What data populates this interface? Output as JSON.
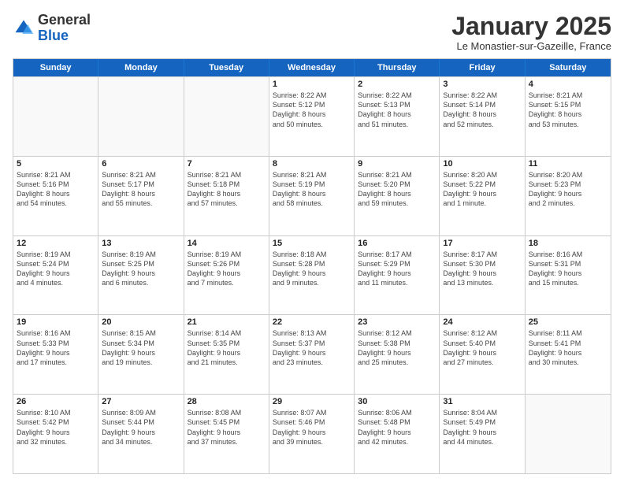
{
  "logo": {
    "general": "General",
    "blue": "Blue"
  },
  "title": "January 2025",
  "subtitle": "Le Monastier-sur-Gazeille, France",
  "headers": [
    "Sunday",
    "Monday",
    "Tuesday",
    "Wednesday",
    "Thursday",
    "Friday",
    "Saturday"
  ],
  "rows": [
    [
      {
        "day": "",
        "lines": []
      },
      {
        "day": "",
        "lines": []
      },
      {
        "day": "",
        "lines": []
      },
      {
        "day": "1",
        "lines": [
          "Sunrise: 8:22 AM",
          "Sunset: 5:12 PM",
          "Daylight: 8 hours",
          "and 50 minutes."
        ]
      },
      {
        "day": "2",
        "lines": [
          "Sunrise: 8:22 AM",
          "Sunset: 5:13 PM",
          "Daylight: 8 hours",
          "and 51 minutes."
        ]
      },
      {
        "day": "3",
        "lines": [
          "Sunrise: 8:22 AM",
          "Sunset: 5:14 PM",
          "Daylight: 8 hours",
          "and 52 minutes."
        ]
      },
      {
        "day": "4",
        "lines": [
          "Sunrise: 8:21 AM",
          "Sunset: 5:15 PM",
          "Daylight: 8 hours",
          "and 53 minutes."
        ]
      }
    ],
    [
      {
        "day": "5",
        "lines": [
          "Sunrise: 8:21 AM",
          "Sunset: 5:16 PM",
          "Daylight: 8 hours",
          "and 54 minutes."
        ]
      },
      {
        "day": "6",
        "lines": [
          "Sunrise: 8:21 AM",
          "Sunset: 5:17 PM",
          "Daylight: 8 hours",
          "and 55 minutes."
        ]
      },
      {
        "day": "7",
        "lines": [
          "Sunrise: 8:21 AM",
          "Sunset: 5:18 PM",
          "Daylight: 8 hours",
          "and 57 minutes."
        ]
      },
      {
        "day": "8",
        "lines": [
          "Sunrise: 8:21 AM",
          "Sunset: 5:19 PM",
          "Daylight: 8 hours",
          "and 58 minutes."
        ]
      },
      {
        "day": "9",
        "lines": [
          "Sunrise: 8:21 AM",
          "Sunset: 5:20 PM",
          "Daylight: 8 hours",
          "and 59 minutes."
        ]
      },
      {
        "day": "10",
        "lines": [
          "Sunrise: 8:20 AM",
          "Sunset: 5:22 PM",
          "Daylight: 9 hours",
          "and 1 minute."
        ]
      },
      {
        "day": "11",
        "lines": [
          "Sunrise: 8:20 AM",
          "Sunset: 5:23 PM",
          "Daylight: 9 hours",
          "and 2 minutes."
        ]
      }
    ],
    [
      {
        "day": "12",
        "lines": [
          "Sunrise: 8:19 AM",
          "Sunset: 5:24 PM",
          "Daylight: 9 hours",
          "and 4 minutes."
        ]
      },
      {
        "day": "13",
        "lines": [
          "Sunrise: 8:19 AM",
          "Sunset: 5:25 PM",
          "Daylight: 9 hours",
          "and 6 minutes."
        ]
      },
      {
        "day": "14",
        "lines": [
          "Sunrise: 8:19 AM",
          "Sunset: 5:26 PM",
          "Daylight: 9 hours",
          "and 7 minutes."
        ]
      },
      {
        "day": "15",
        "lines": [
          "Sunrise: 8:18 AM",
          "Sunset: 5:28 PM",
          "Daylight: 9 hours",
          "and 9 minutes."
        ]
      },
      {
        "day": "16",
        "lines": [
          "Sunrise: 8:17 AM",
          "Sunset: 5:29 PM",
          "Daylight: 9 hours",
          "and 11 minutes."
        ]
      },
      {
        "day": "17",
        "lines": [
          "Sunrise: 8:17 AM",
          "Sunset: 5:30 PM",
          "Daylight: 9 hours",
          "and 13 minutes."
        ]
      },
      {
        "day": "18",
        "lines": [
          "Sunrise: 8:16 AM",
          "Sunset: 5:31 PM",
          "Daylight: 9 hours",
          "and 15 minutes."
        ]
      }
    ],
    [
      {
        "day": "19",
        "lines": [
          "Sunrise: 8:16 AM",
          "Sunset: 5:33 PM",
          "Daylight: 9 hours",
          "and 17 minutes."
        ]
      },
      {
        "day": "20",
        "lines": [
          "Sunrise: 8:15 AM",
          "Sunset: 5:34 PM",
          "Daylight: 9 hours",
          "and 19 minutes."
        ]
      },
      {
        "day": "21",
        "lines": [
          "Sunrise: 8:14 AM",
          "Sunset: 5:35 PM",
          "Daylight: 9 hours",
          "and 21 minutes."
        ]
      },
      {
        "day": "22",
        "lines": [
          "Sunrise: 8:13 AM",
          "Sunset: 5:37 PM",
          "Daylight: 9 hours",
          "and 23 minutes."
        ]
      },
      {
        "day": "23",
        "lines": [
          "Sunrise: 8:12 AM",
          "Sunset: 5:38 PM",
          "Daylight: 9 hours",
          "and 25 minutes."
        ]
      },
      {
        "day": "24",
        "lines": [
          "Sunrise: 8:12 AM",
          "Sunset: 5:40 PM",
          "Daylight: 9 hours",
          "and 27 minutes."
        ]
      },
      {
        "day": "25",
        "lines": [
          "Sunrise: 8:11 AM",
          "Sunset: 5:41 PM",
          "Daylight: 9 hours",
          "and 30 minutes."
        ]
      }
    ],
    [
      {
        "day": "26",
        "lines": [
          "Sunrise: 8:10 AM",
          "Sunset: 5:42 PM",
          "Daylight: 9 hours",
          "and 32 minutes."
        ]
      },
      {
        "day": "27",
        "lines": [
          "Sunrise: 8:09 AM",
          "Sunset: 5:44 PM",
          "Daylight: 9 hours",
          "and 34 minutes."
        ]
      },
      {
        "day": "28",
        "lines": [
          "Sunrise: 8:08 AM",
          "Sunset: 5:45 PM",
          "Daylight: 9 hours",
          "and 37 minutes."
        ]
      },
      {
        "day": "29",
        "lines": [
          "Sunrise: 8:07 AM",
          "Sunset: 5:46 PM",
          "Daylight: 9 hours",
          "and 39 minutes."
        ]
      },
      {
        "day": "30",
        "lines": [
          "Sunrise: 8:06 AM",
          "Sunset: 5:48 PM",
          "Daylight: 9 hours",
          "and 42 minutes."
        ]
      },
      {
        "day": "31",
        "lines": [
          "Sunrise: 8:04 AM",
          "Sunset: 5:49 PM",
          "Daylight: 9 hours",
          "and 44 minutes."
        ]
      },
      {
        "day": "",
        "lines": []
      }
    ]
  ]
}
